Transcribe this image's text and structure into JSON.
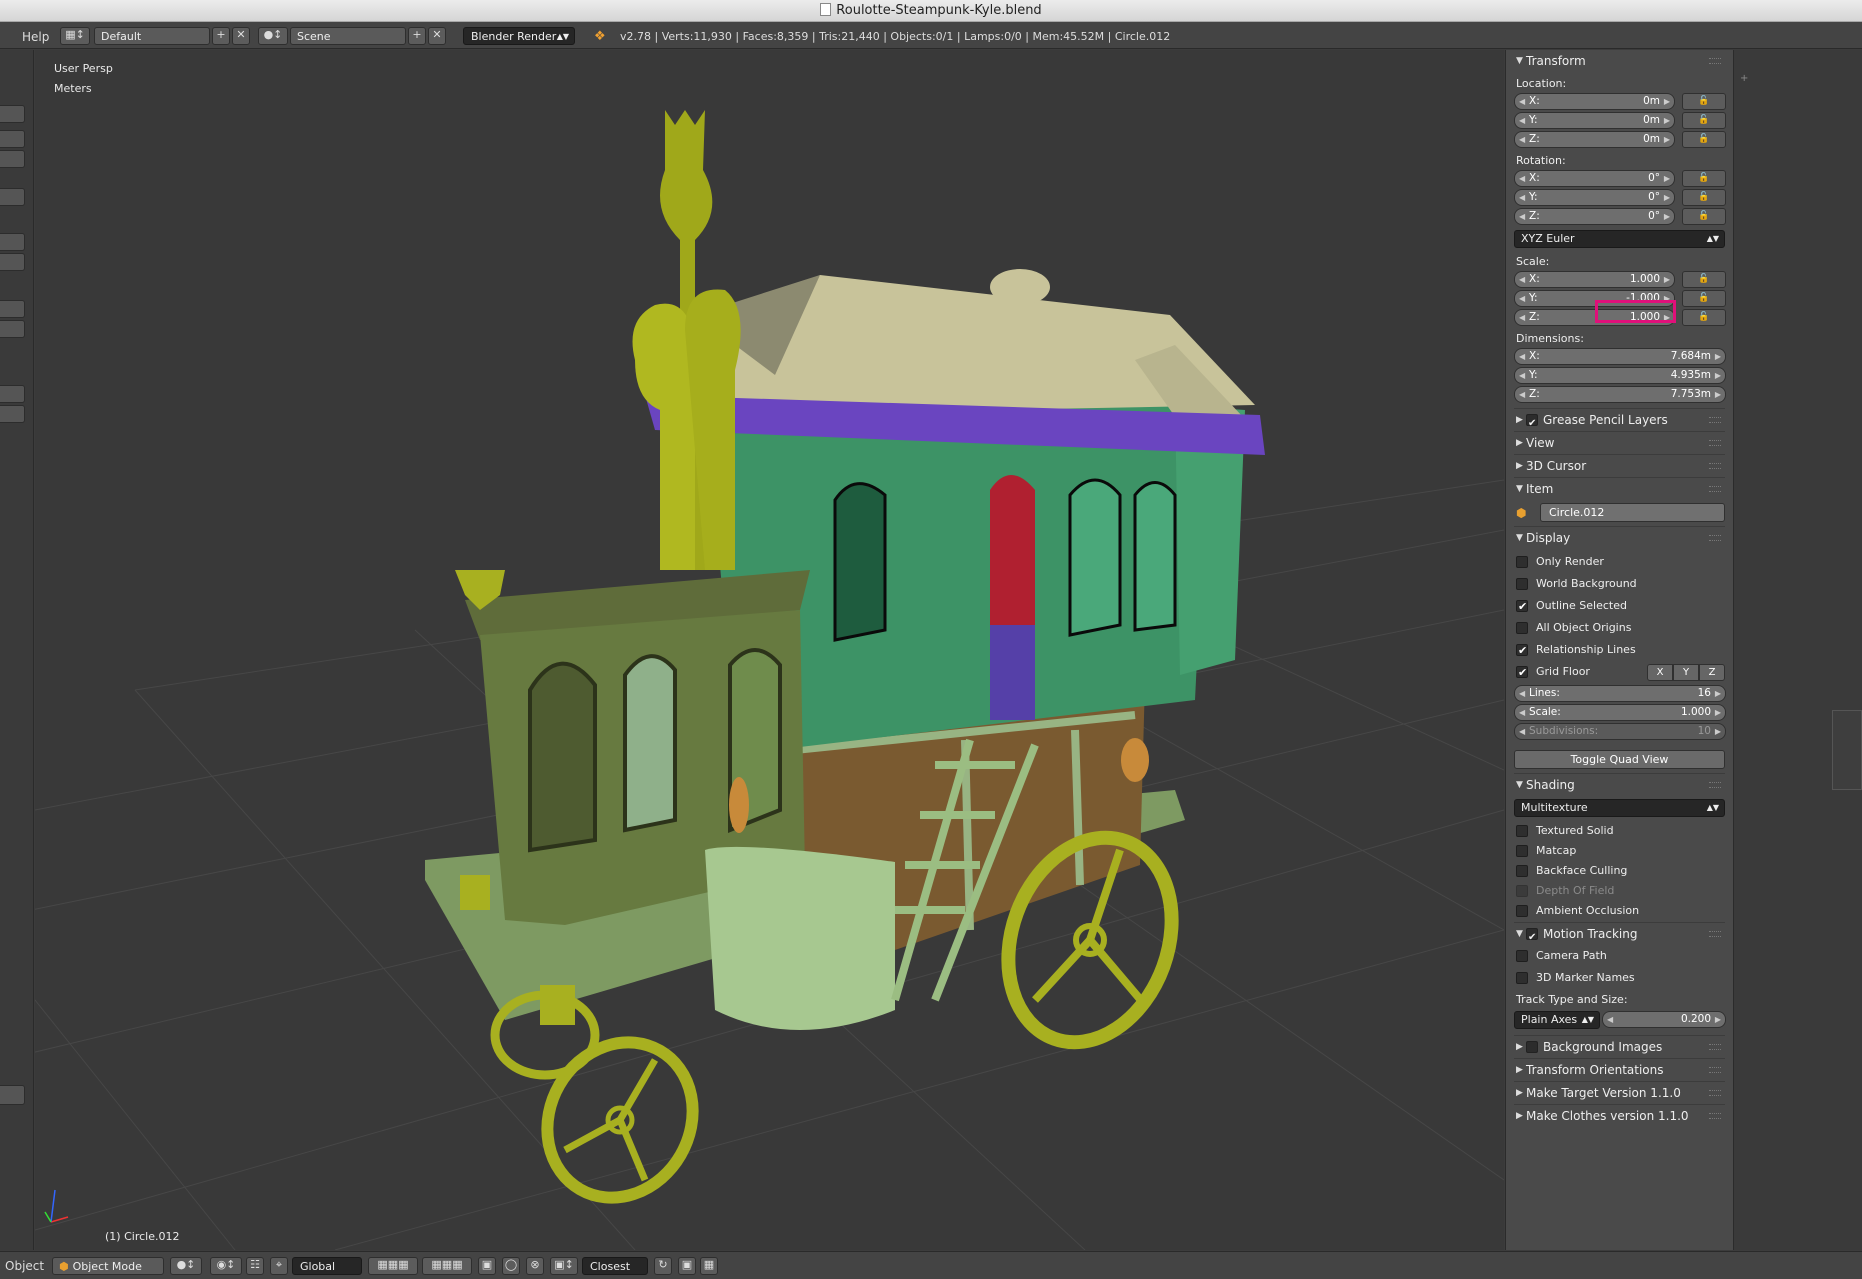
{
  "window": {
    "title": "Roulotte-Steampunk-Kyle.blend"
  },
  "topbar": {
    "help_menu": "Help",
    "layout": "Default",
    "scene": "Scene",
    "engine": "Blender Render",
    "stats": "v2.78 | Verts:11,930 | Faces:8,359 | Tris:21,440 | Objects:0/1 | Lamps:0/0 | Mem:45.52M | Circle.012"
  },
  "viewport": {
    "view_name": "User Persp",
    "units": "Meters",
    "object_label": "(1) Circle.012"
  },
  "npanel": {
    "transform": {
      "header": "Transform",
      "location_label": "Location:",
      "location": [
        {
          "k": "X:",
          "v": "0m"
        },
        {
          "k": "Y:",
          "v": "0m"
        },
        {
          "k": "Z:",
          "v": "0m"
        }
      ],
      "rotation_label": "Rotation:",
      "rotation": [
        {
          "k": "X:",
          "v": "0°"
        },
        {
          "k": "Y:",
          "v": "0°"
        },
        {
          "k": "Z:",
          "v": "0°"
        }
      ],
      "rotation_mode": "XYZ Euler",
      "scale_label": "Scale:",
      "scale": [
        {
          "k": "X:",
          "v": "1.000"
        },
        {
          "k": "Y:",
          "v": "-1.000"
        },
        {
          "k": "Z:",
          "v": "1.000"
        }
      ],
      "dimensions_label": "Dimensions:",
      "dimensions": [
        {
          "k": "X:",
          "v": "7.684m"
        },
        {
          "k": "Y:",
          "v": "4.935m"
        },
        {
          "k": "Z:",
          "v": "7.753m"
        }
      ]
    },
    "grease_pencil": "Grease Pencil Layers",
    "view": "View",
    "cursor": "3D Cursor",
    "item": {
      "header": "Item",
      "name": "Circle.012"
    },
    "display": {
      "header": "Display",
      "only_render": "Only Render",
      "world_background": "World Background",
      "outline_selected": "Outline Selected",
      "all_origins": "All Object Origins",
      "relationship_lines": "Relationship Lines",
      "grid_floor": "Grid Floor",
      "axis_x": "X",
      "axis_y": "Y",
      "axis_z": "Z",
      "lines_k": "Lines:",
      "lines_v": "16",
      "scale_k": "Scale:",
      "scale_v": "1.000",
      "subdiv_k": "Subdivisions:",
      "subdiv_v": "10",
      "toggle_quad": "Toggle Quad View"
    },
    "shading": {
      "header": "Shading",
      "mode": "Multitexture",
      "textured_solid": "Textured Solid",
      "matcap": "Matcap",
      "backface_culling": "Backface Culling",
      "depth_of_field": "Depth Of Field",
      "ambient_occlusion": "Ambient Occlusion"
    },
    "motion_tracking": {
      "header": "Motion Tracking",
      "camera_path": "Camera Path",
      "marker_names": "3D Marker Names",
      "track_label": "Track Type and Size:",
      "track_type": "Plain Axes",
      "track_size": "0.200"
    },
    "background_images": "Background Images",
    "transform_orientations": "Transform Orientations",
    "make_target": "Make Target  Version 1.1.0",
    "make_clothes": "Make Clothes version 1.1.0"
  },
  "bottombar": {
    "object_menu": "Object",
    "mode": "Object Mode",
    "orientation": "Global",
    "snap": "Closest"
  }
}
